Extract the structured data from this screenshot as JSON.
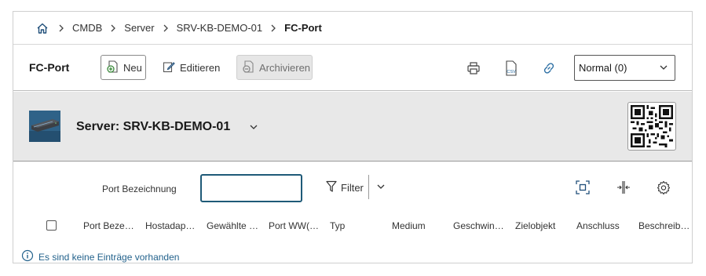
{
  "breadcrumb": {
    "home_icon": "home-icon",
    "items": [
      "CMDB",
      "Server",
      "SRV-KB-DEMO-01"
    ],
    "current": "FC-Port"
  },
  "toolbar": {
    "title": "FC-Port",
    "new_label": "Neu",
    "edit_label": "Editieren",
    "archive_label": "Archivieren",
    "icons": [
      "printer-icon",
      "csv-export-icon",
      "link-icon"
    ],
    "view_select": "Normal (0)"
  },
  "object": {
    "title": "Server: SRV-KB-DEMO-01",
    "qr_icon": "qr-code-icon"
  },
  "filter": {
    "label": "Port Bezeichnung",
    "input_value": "",
    "button_label": "Filter"
  },
  "table": {
    "columns": [
      "Port Beze…",
      "Hostadap…",
      "Gewählte …",
      "Port WW(…",
      "Typ",
      "Medium",
      "Geschwin…",
      "Zielobjekt",
      "Anschluss",
      "Beschreib…"
    ]
  },
  "empty_message": "Es sind keine Einträge vorhanden",
  "colors": {
    "accent": "#1f5a78",
    "link_blue": "#23628c",
    "header_gray": "#e8e8e8"
  }
}
